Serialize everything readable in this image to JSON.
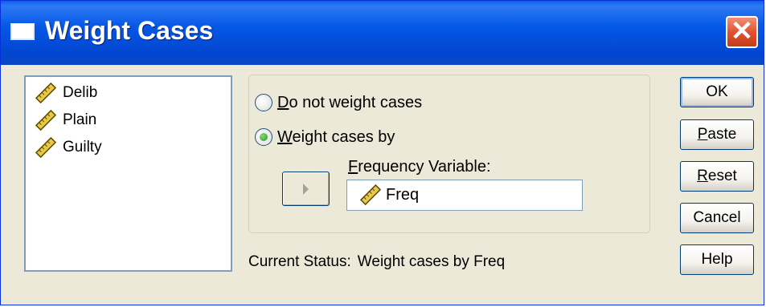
{
  "window": {
    "title": "Weight Cases",
    "close_glyph": "✕"
  },
  "variables": {
    "items": [
      {
        "label": "Delib",
        "icon": "scale-ruler-icon"
      },
      {
        "label": "Plain",
        "icon": "scale-ruler-icon"
      },
      {
        "label": "Guilty",
        "icon": "scale-ruler-icon"
      }
    ]
  },
  "options": {
    "no_weight": {
      "mnemonic": "D",
      "rest": "o not weight cases",
      "selected": false
    },
    "weight_by": {
      "mnemonic": "W",
      "rest": "eight cases by",
      "selected": true
    }
  },
  "frequency": {
    "label_mnemonic": "F",
    "label_rest": "requency Variable:",
    "value": "Freq",
    "icon": "scale-ruler-icon"
  },
  "move_button": {
    "icon": "right-arrow-icon"
  },
  "status": {
    "label": "Current Status:",
    "value": "Weight cases by Freq"
  },
  "buttons": {
    "ok": "OK",
    "paste_mnemonic": "P",
    "paste_rest": "aste",
    "reset_mnemonic": "R",
    "reset_rest": "eset",
    "cancel": "Cancel",
    "help": "Help"
  },
  "colors": {
    "titlebar": "#0558e6",
    "close": "#e2522f",
    "dialog_bg": "#ece9d8",
    "radio_dot": "#21a121"
  }
}
